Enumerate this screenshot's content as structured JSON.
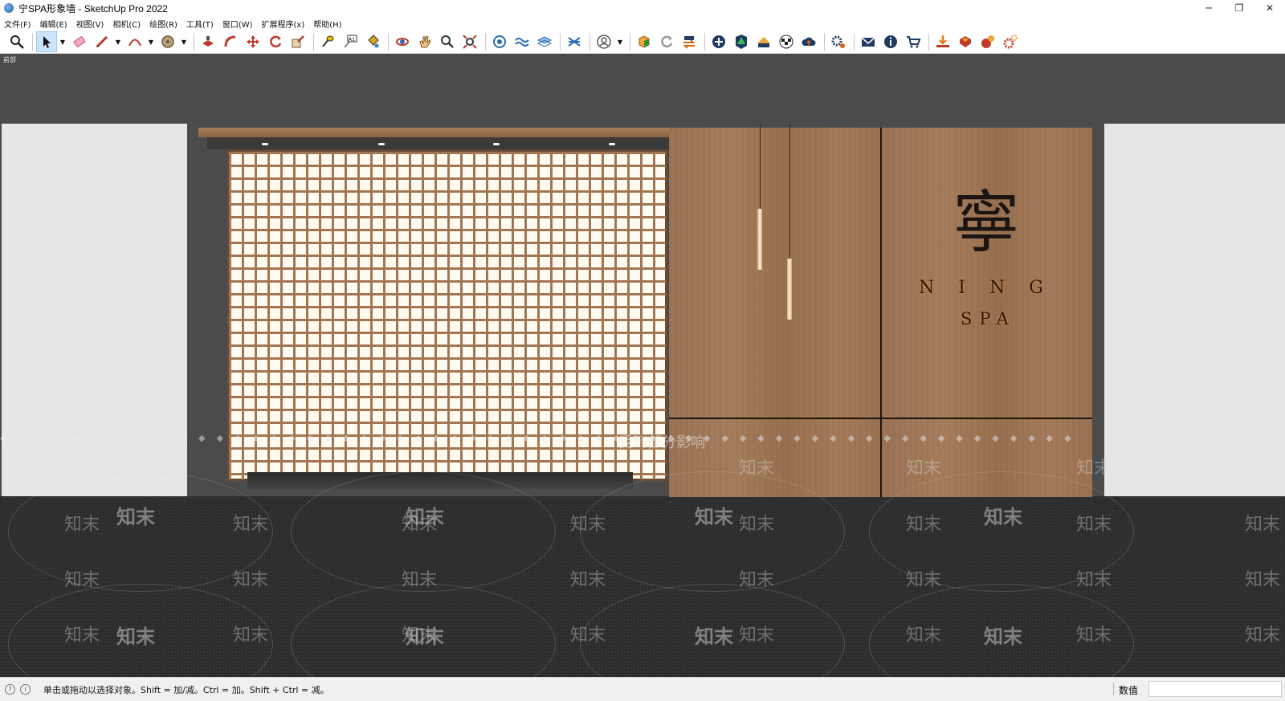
{
  "window": {
    "title": "宁SPA形象墙 - SketchUp Pro 2022",
    "controls": {
      "minimize": "─",
      "restore": "❐",
      "close": "✕"
    }
  },
  "menu": {
    "items": [
      "文件(F)",
      "编辑(E)",
      "视图(V)",
      "相机(C)",
      "绘图(R)",
      "工具(T)",
      "窗口(W)",
      "扩展程序(x)",
      "帮助(H)"
    ]
  },
  "toolbar": {
    "tools": [
      "zoom",
      "select",
      "eraser",
      "pencil-line",
      "arc",
      "tape-measure",
      "push-pull",
      "follow-me",
      "move",
      "rotate",
      "scale",
      "tape",
      "text",
      "paint-bucket",
      "orbit",
      "pan",
      "zoom-tool",
      "zoom-extents",
      "components",
      "sandbox",
      "layers",
      "styles",
      "account",
      "warehouse",
      "sync",
      "export",
      "add",
      "tree",
      "roof",
      "pattern",
      "cloud-upload",
      "settings",
      "mail",
      "info",
      "cart",
      "import",
      "ruby",
      "extension",
      "gear"
    ]
  },
  "viewport": {
    "scene_label": "前部",
    "logo": {
      "char": "寧",
      "line1": "NING",
      "line2": "SPA"
    },
    "watermark_text": "知末",
    "notice_text": "受到部分影响"
  },
  "status": {
    "hint": "单击或拖动以选择对象。Shift = 加/减。Ctrl = 加。Shift + Ctrl = 减。",
    "measurements_label": "数值",
    "measurements_value": ""
  },
  "colors": {
    "viewport_bg": "#4a4a4a",
    "wall": "#e6e6e6",
    "wood": "#a27a58",
    "floor": "#2d2d30",
    "screen_glow": "#fffbf0"
  }
}
